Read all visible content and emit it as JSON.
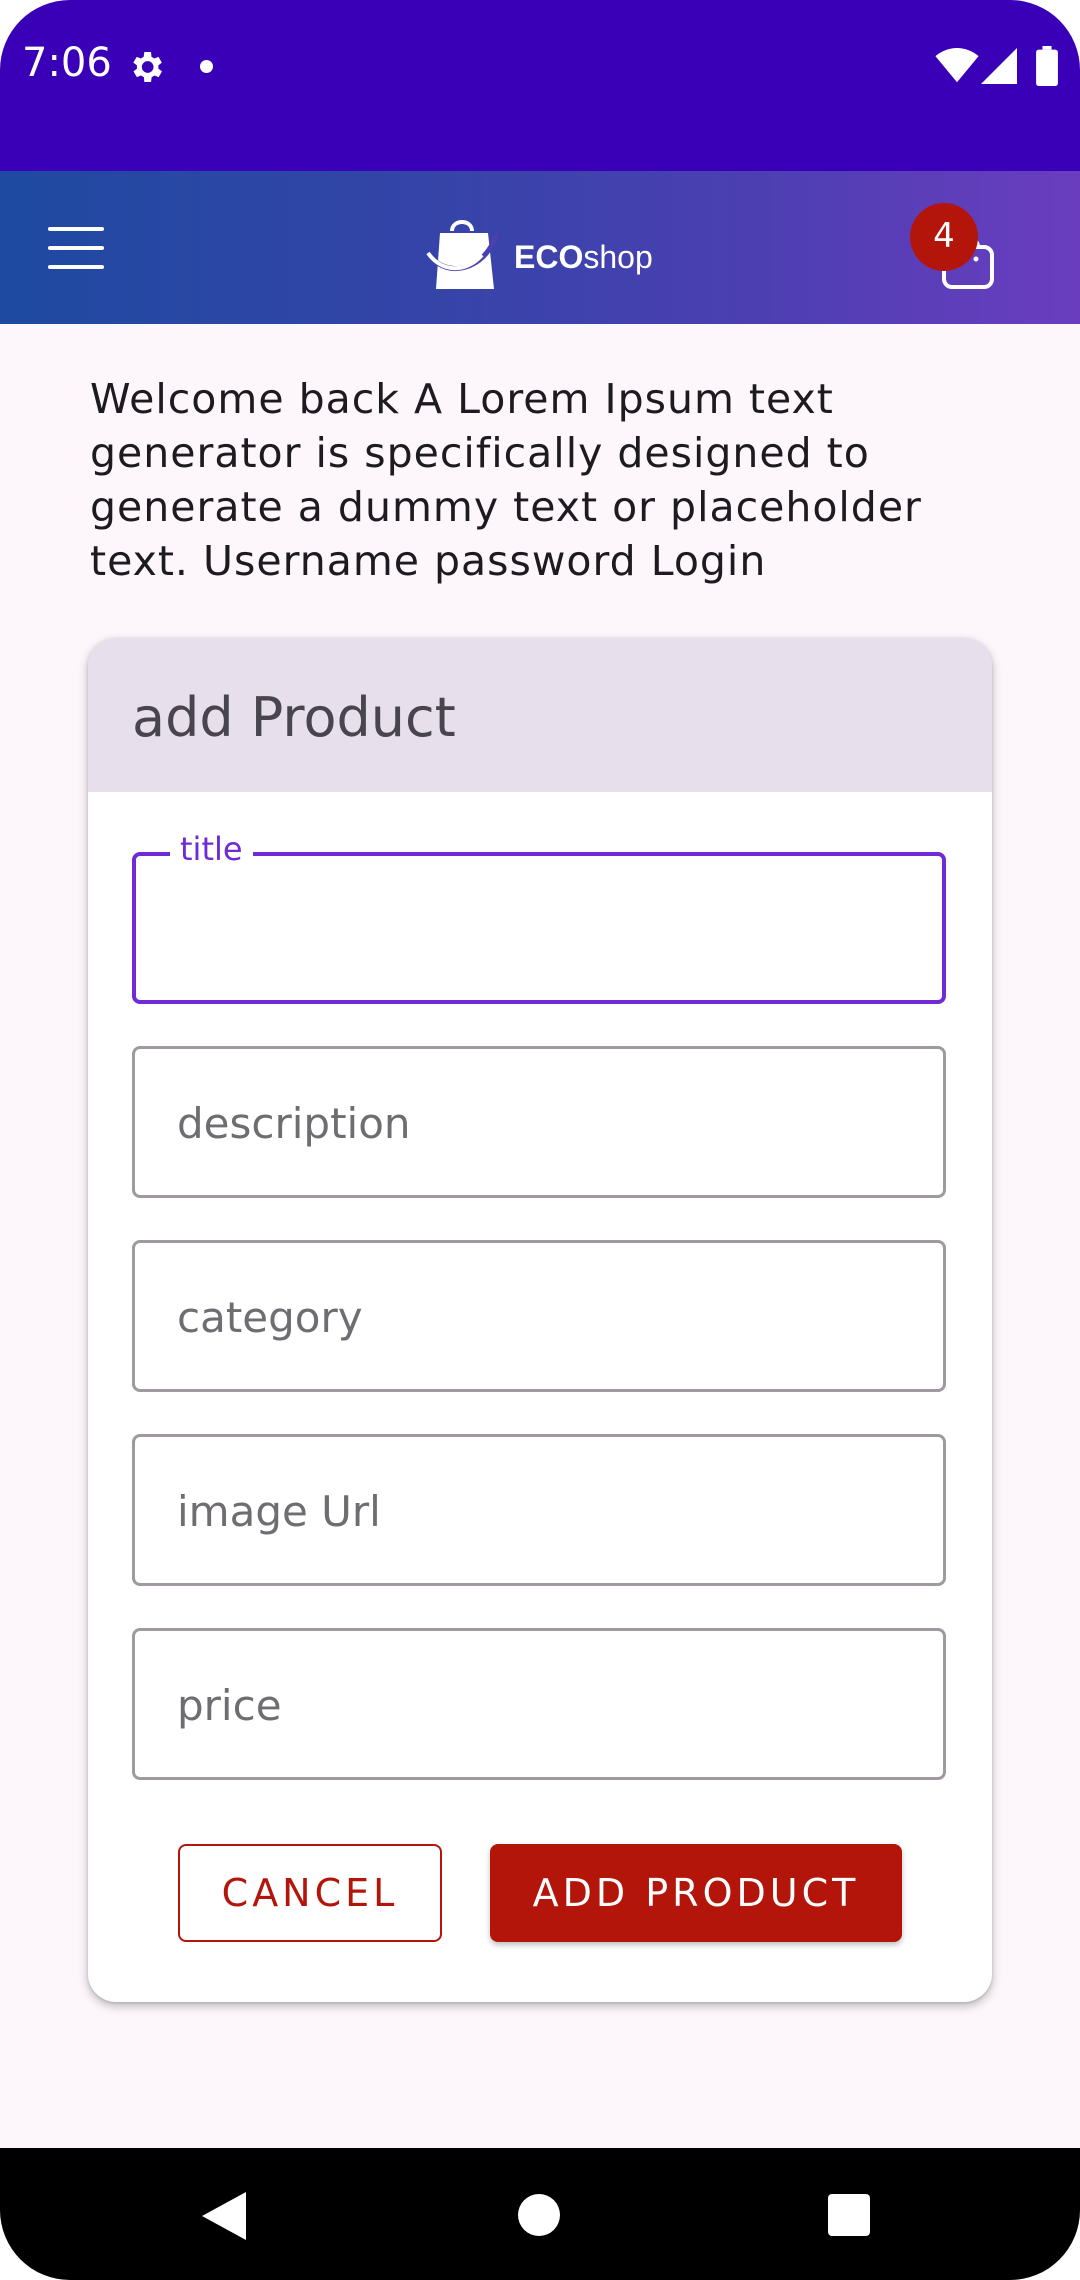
{
  "status_bar": {
    "time": "7:06",
    "icons": [
      "gear-icon",
      "notification-dot-icon",
      "wifi-icon",
      "signal-icon",
      "battery-icon"
    ]
  },
  "app_bar": {
    "logo_bold": "ECO",
    "logo_light": "shop",
    "cart_count": "4",
    "icons": [
      "menu-icon",
      "shopping-bag-logo-icon",
      "cart-bag-icon"
    ]
  },
  "welcome_text": "Welcome back A Lorem Ipsum text generator is specifically designed to generate a dummy text or placeholder text. Username password Login",
  "card": {
    "title": "add Product",
    "fields": [
      {
        "label": "title",
        "value": "",
        "focused": true
      },
      {
        "placeholder": "description",
        "value": ""
      },
      {
        "placeholder": "category",
        "value": ""
      },
      {
        "placeholder": "image Url",
        "value": ""
      },
      {
        "placeholder": "price",
        "value": ""
      }
    ],
    "cancel_label": "CANCEL",
    "add_label": "ADD PRODUCT"
  },
  "colors": {
    "status_bar": "#3a00b8",
    "accent_purple": "#6f2bd6",
    "action_red": "#b3150b",
    "card_header": "#e7e0ec"
  }
}
